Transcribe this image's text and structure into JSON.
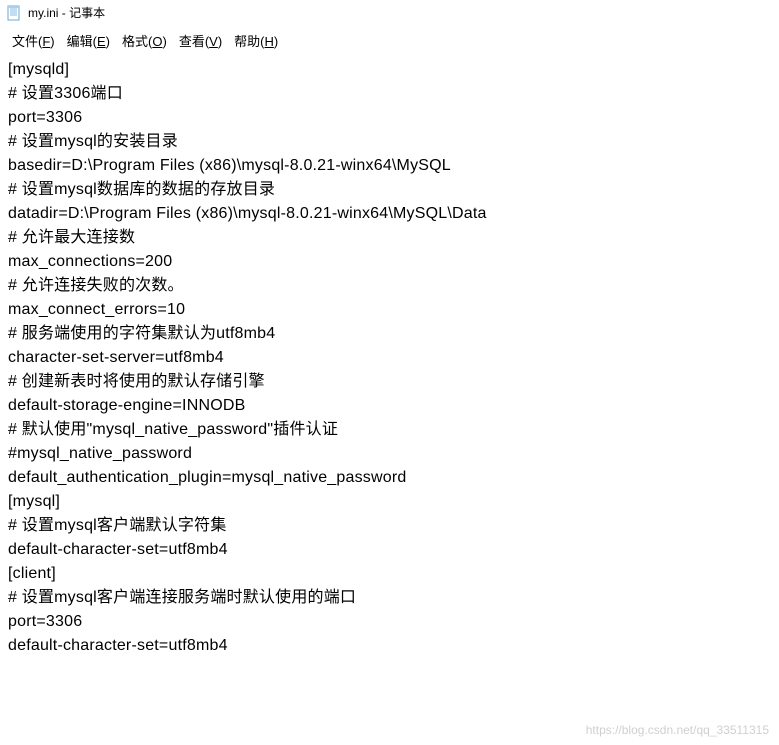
{
  "window": {
    "title": "my.ini - 记事本"
  },
  "menubar": {
    "file": "文件(F)",
    "edit": "编辑(E)",
    "format": "格式(O)",
    "view": "查看(V)",
    "help": "帮助(H)"
  },
  "lines": [
    "[mysqld]",
    "# 设置3306端口",
    "port=3306",
    "# 设置mysql的安装目录",
    "basedir=D:\\Program Files (x86)\\mysql-8.0.21-winx64\\MySQL",
    "# 设置mysql数据库的数据的存放目录",
    "datadir=D:\\Program Files (x86)\\mysql-8.0.21-winx64\\MySQL\\Data",
    "# 允许最大连接数",
    "max_connections=200",
    "# 允许连接失败的次数。",
    "max_connect_errors=10",
    "# 服务端使用的字符集默认为utf8mb4",
    "character-set-server=utf8mb4",
    "# 创建新表时将使用的默认存储引擎",
    "default-storage-engine=INNODB",
    "# 默认使用\"mysql_native_password\"插件认证",
    "#mysql_native_password",
    "default_authentication_plugin=mysql_native_password",
    "[mysql]",
    "# 设置mysql客户端默认字符集",
    "default-character-set=utf8mb4",
    "[client]",
    "# 设置mysql客户端连接服务端时默认使用的端口",
    "port=3306",
    "default-character-set=utf8mb4"
  ],
  "watermark": "https://blog.csdn.net/qq_33511315"
}
